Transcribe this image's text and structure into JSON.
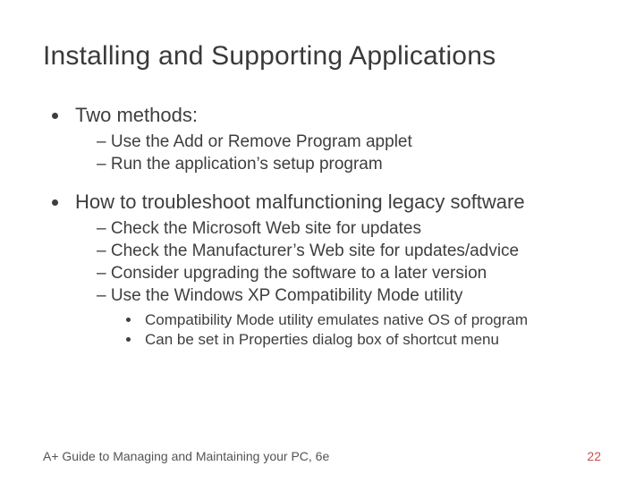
{
  "title": "Installing and Supporting Applications",
  "bullets": {
    "b1": "Two methods:",
    "b1_1": "Use the Add or Remove Program applet",
    "b1_2": "Run the application’s setup program",
    "b2": "How to troubleshoot malfunctioning legacy software",
    "b2_1": "Check the Microsoft Web site for updates",
    "b2_2": "Check the Manufacturer’s Web site for updates/advice",
    "b2_3": "Consider upgrading the software to a later version",
    "b2_4": "Use the Windows XP Compatibility Mode utility",
    "b2_4_1": "Compatibility Mode utility emulates native OS of program",
    "b2_4_2": "Can be set in Properties dialog box of shortcut menu"
  },
  "footer": "A+ Guide to Managing and Maintaining your PC, 6e",
  "pagenum": "22"
}
